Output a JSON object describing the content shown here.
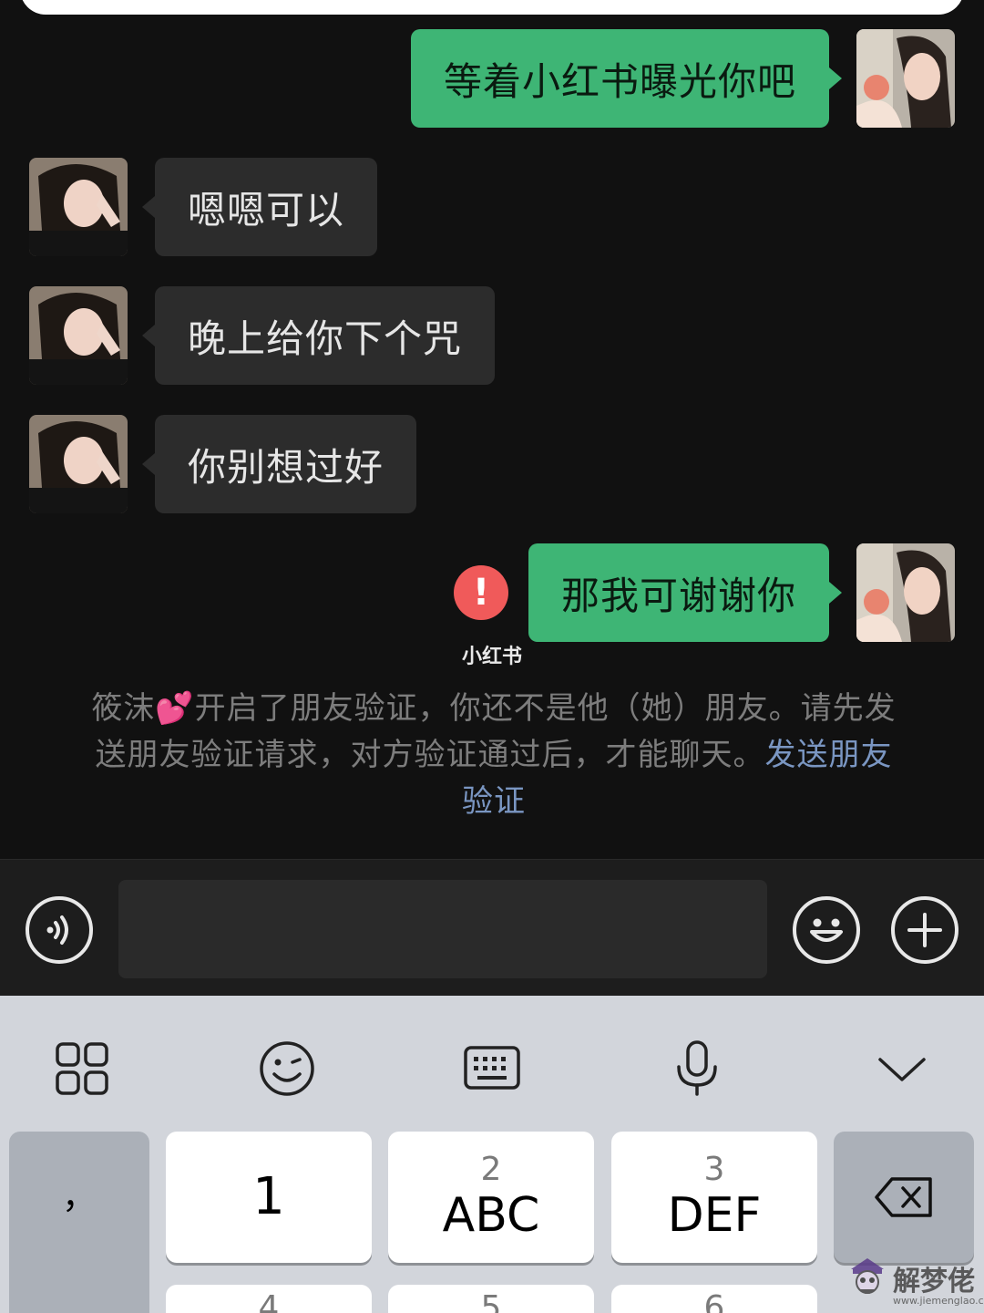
{
  "messages": [
    {
      "side": "sent",
      "text": "等着小红书曝光你吧"
    },
    {
      "side": "recv",
      "text": "嗯嗯可以"
    },
    {
      "side": "recv",
      "text": "晚上给你下个咒"
    },
    {
      "side": "recv",
      "text": "你别想过好"
    },
    {
      "side": "sent",
      "text": "那我可谢谢你",
      "error_icon": "!"
    }
  ],
  "watermark": "小红书",
  "notice": {
    "text_before": "筱沫",
    "emoji": "💕",
    "text": "开启了朋友验证，你还不是他（她）朋友。请先发送朋友验证请求，对方验证通过后，才能聊天。",
    "link": "发送朋友验证"
  },
  "input_bar": {
    "icons": [
      "voice-icon",
      "emoji-icon",
      "plus-icon"
    ],
    "value": ""
  },
  "keyboard": {
    "toolbar_icons": [
      "grid-icon",
      "smile-icon",
      "keyboard-icon",
      "mic-icon",
      "chevron-down-icon"
    ],
    "punct_key": {
      "top": "，",
      "bottom": "。"
    },
    "keys": [
      {
        "num": "",
        "letters": "1"
      },
      {
        "num": "2",
        "letters": "ABC"
      },
      {
        "num": "3",
        "letters": "DEF"
      }
    ],
    "next_row_nums": [
      "4",
      "5",
      "6"
    ],
    "delete_icon": "backspace-icon"
  },
  "site_logo": {
    "text": "解梦佬",
    "url": "www.jiemenglao.com"
  },
  "colors": {
    "sent_bubble": "#3eb575",
    "recv_bubble": "#2c2c2c",
    "background": "#111111",
    "error": "#f05a5a",
    "link": "#7a96c2"
  }
}
